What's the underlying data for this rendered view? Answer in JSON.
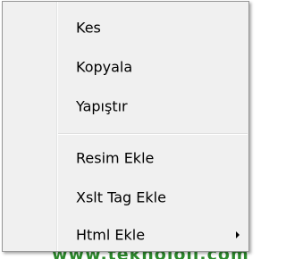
{
  "underlay": {
    "text": "www.teknoloji.com"
  },
  "context_menu": {
    "items": [
      {
        "label": "Kes"
      },
      {
        "label": "Kopyala"
      },
      {
        "label": "Yapıştır"
      },
      {
        "label": "Resim Ekle"
      },
      {
        "label": "Xslt Tag Ekle"
      },
      {
        "label": "Html Ekle",
        "has_submenu": true,
        "submenu_icon": "chevron-right-icon"
      }
    ]
  }
}
